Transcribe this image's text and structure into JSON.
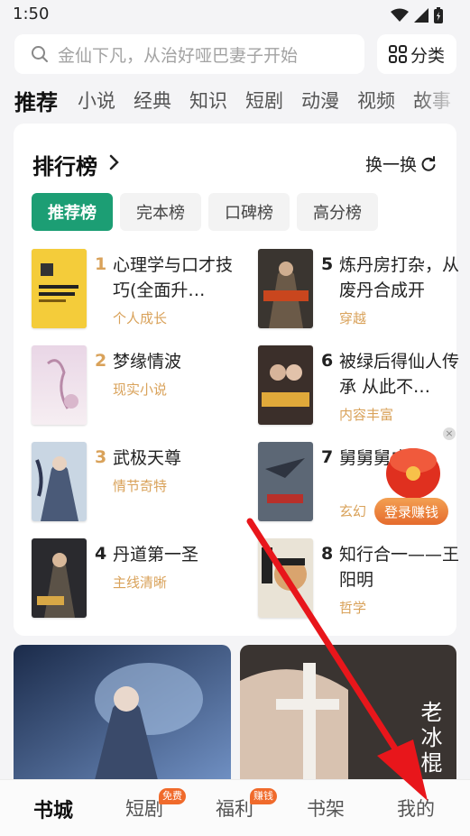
{
  "status": {
    "time": "1:50"
  },
  "search": {
    "placeholder": "金仙下凡，从治好哑巴妻子开始",
    "category_label": "分类"
  },
  "top_tabs": [
    {
      "label": "推荐",
      "active": true
    },
    {
      "label": "小说"
    },
    {
      "label": "经典"
    },
    {
      "label": "知识"
    },
    {
      "label": "短剧"
    },
    {
      "label": "动漫"
    },
    {
      "label": "视频"
    },
    {
      "label": "故事"
    }
  ],
  "ranking": {
    "title": "排行榜",
    "refresh_label": "换一换",
    "tabs": [
      "推荐榜",
      "完本榜",
      "口碑榜",
      "高分榜"
    ],
    "books": [
      {
        "rank": "1",
        "title": "心理学与口才技巧(全面升…",
        "tag": "个人成长"
      },
      {
        "rank": "2",
        "title": "梦缘情波",
        "tag": "现实小说"
      },
      {
        "rank": "3",
        "title": "武极天尊",
        "tag": "情节奇特"
      },
      {
        "rank": "4",
        "title": "丹道第一圣",
        "tag": "主线清晰"
      },
      {
        "rank": "5",
        "title": "炼丹房打杂，从废丹合成开",
        "tag": "穿越"
      },
      {
        "rank": "6",
        "title": "被绿后得仙人传承 从此不…",
        "tag": "内容丰富"
      },
      {
        "rank": "7",
        "title": "舅舅舅成魔",
        "tag": "玄幻"
      },
      {
        "rank": "8",
        "title": "知行合一——王阳明",
        "tag": "哲学"
      }
    ]
  },
  "promo": {
    "label": "登录赚钱"
  },
  "banner_right": {
    "text": "老冰棍"
  },
  "bottom_nav": [
    {
      "label": "书城",
      "active": true
    },
    {
      "label": "短剧",
      "badge": "免费"
    },
    {
      "label": "福利",
      "badge": "赚钱"
    },
    {
      "label": "书架"
    },
    {
      "label": "我的"
    }
  ],
  "colors": {
    "accent": "#1c9e74",
    "tag": "#d9a25a",
    "badge": "#f06a2b",
    "annotation_arrow": "#e8161b"
  }
}
